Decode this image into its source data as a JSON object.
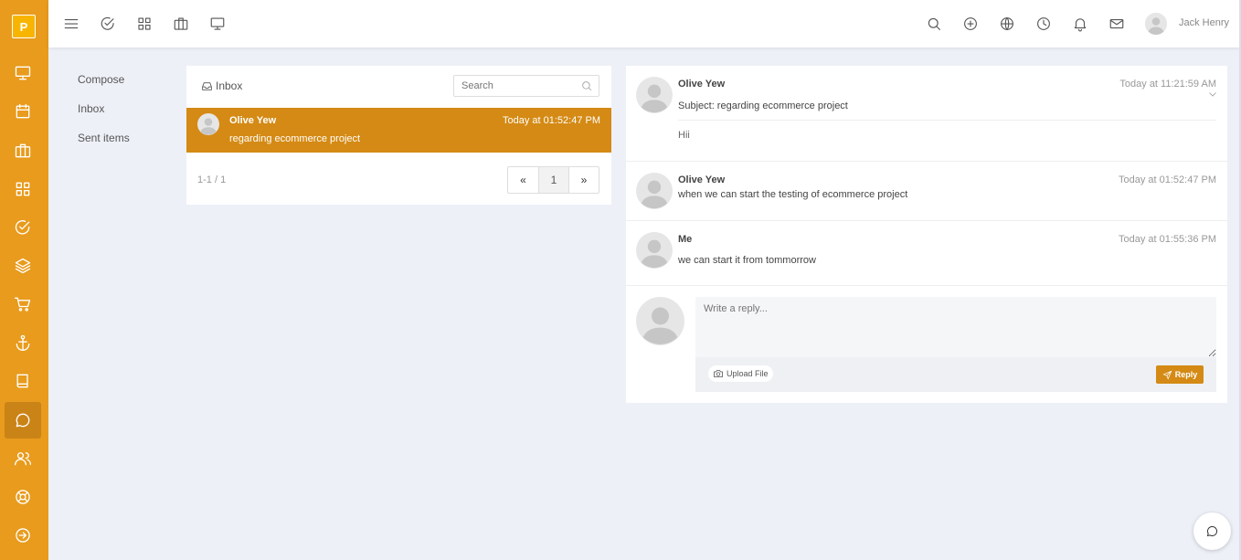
{
  "app": {
    "logo_letter": "P",
    "accent_color": "#e89b1d",
    "active_row_color": "#d48a14"
  },
  "sidebar": {
    "items": [
      {
        "icon": "monitor-icon"
      },
      {
        "icon": "calendar-icon"
      },
      {
        "icon": "briefcase-icon"
      },
      {
        "icon": "grid-icon"
      },
      {
        "icon": "check-circle-icon"
      },
      {
        "icon": "layers-icon"
      },
      {
        "icon": "cart-icon"
      },
      {
        "icon": "anchor-icon"
      },
      {
        "icon": "book-icon"
      },
      {
        "icon": "chat-icon",
        "active": true
      },
      {
        "icon": "users-icon"
      },
      {
        "icon": "lifebuoy-icon"
      },
      {
        "icon": "logout-icon"
      }
    ]
  },
  "topbar": {
    "left_icons": [
      "menu-icon",
      "check-circle-icon",
      "grid-icon",
      "briefcase-icon",
      "monitor-icon"
    ],
    "right_icons": [
      "search-icon",
      "plus-circle-icon",
      "globe-icon",
      "clock-icon",
      "bell-icon",
      "mail-icon"
    ],
    "user_name": "Jack Henry"
  },
  "mail_nav": {
    "compose": "Compose",
    "inbox": "Inbox",
    "sent": "Sent items"
  },
  "inbox": {
    "title": "Inbox",
    "search_placeholder": "Search",
    "messages": [
      {
        "sender": "Olive Yew",
        "date": "Today at 01:52:47 PM",
        "subject": "regarding ecommerce project"
      }
    ],
    "pagination": {
      "info": "1-1 / 1",
      "prev": "«",
      "current": "1",
      "next": "»"
    }
  },
  "thread": {
    "messages": [
      {
        "sender": "Olive Yew",
        "date": "Today at 11:21:59 AM",
        "subject": "Subject: regarding ecommerce project",
        "body": "Hii"
      },
      {
        "sender": "Olive Yew",
        "date": "Today at 01:52:47 PM",
        "body": "when we can start the testing of ecommerce project"
      },
      {
        "sender": "Me",
        "date": "Today at 01:55:36 PM",
        "body": "we can start it from tommorrow"
      }
    ],
    "reply": {
      "placeholder": "Write a reply...",
      "upload_label": "Upload File",
      "reply_label": "Reply"
    }
  }
}
